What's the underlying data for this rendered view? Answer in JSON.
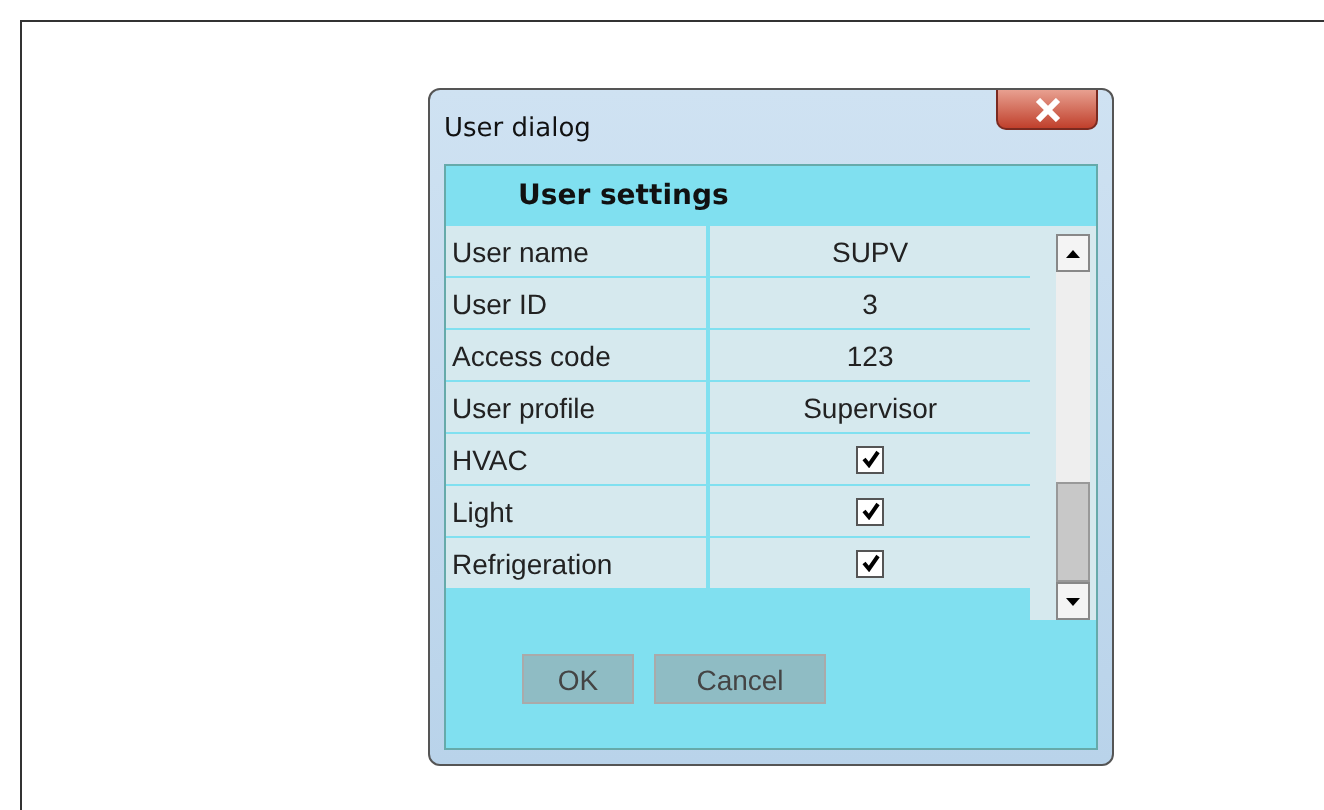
{
  "dialog": {
    "title": "User dialog",
    "header": "User settings",
    "rows": [
      {
        "label": "User name",
        "kind": "text",
        "value": "SUPV"
      },
      {
        "label": "User ID",
        "kind": "text",
        "value": "3"
      },
      {
        "label": "Access code",
        "kind": "text",
        "value": "123"
      },
      {
        "label": "User profile",
        "kind": "text",
        "value": "Supervisor"
      },
      {
        "label": "HVAC",
        "kind": "checkbox",
        "checked": true
      },
      {
        "label": "Light",
        "kind": "checkbox",
        "checked": true
      },
      {
        "label": "Refrigeration",
        "kind": "checkbox",
        "checked": true
      }
    ],
    "buttons": [
      "OK",
      "Cancel"
    ]
  }
}
